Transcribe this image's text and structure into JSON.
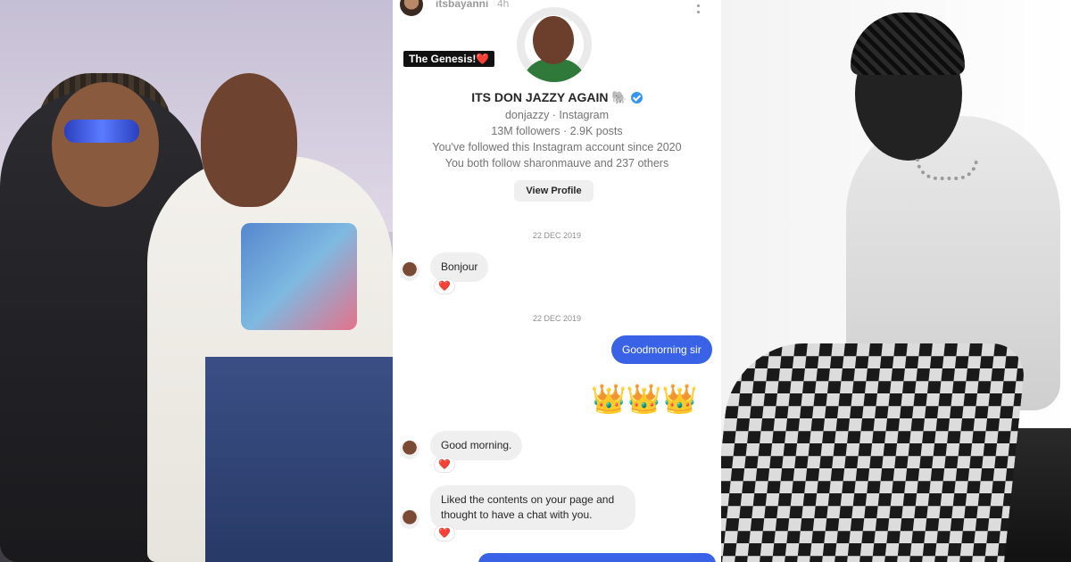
{
  "story": {
    "username": "itsbayanni",
    "time": "4h",
    "caption": "The Genesis!❤️"
  },
  "profile": {
    "name": "ITS DON JAZZY AGAIN 🐘",
    "handle_line": "donjazzy · Instagram",
    "stats_line": "13M followers · 2.9K posts",
    "followed_since": "You've followed this Instagram account since 2020",
    "mutual_line": "You both follow sharonmauve and 237 others",
    "view_profile_label": "View Profile"
  },
  "chat": {
    "date_1": "22 DEC 2019",
    "date_2": "22 DEC 2019",
    "messages": [
      {
        "direction": "in",
        "text": "Bonjour",
        "reaction": "❤️"
      },
      {
        "direction": "out",
        "text": "Goodmorning sir"
      },
      {
        "direction": "out",
        "text": "👑👑👑"
      },
      {
        "direction": "in",
        "text": "Good morning.",
        "reaction": "❤️"
      },
      {
        "direction": "in",
        "text": "Liked the contents on your page and thought to have a chat with you.",
        "reaction": "❤️"
      }
    ]
  },
  "colors": {
    "outgoing_bubble": "#3a62e7",
    "incoming_bubble": "#efefef",
    "verified": "#3797f0",
    "reaction_heart": "#e0245e"
  },
  "icons": {
    "crown": "crown-icon",
    "more": "more-vertical-icon",
    "verified": "verified-badge-icon",
    "heart": "heart-reaction-icon"
  }
}
